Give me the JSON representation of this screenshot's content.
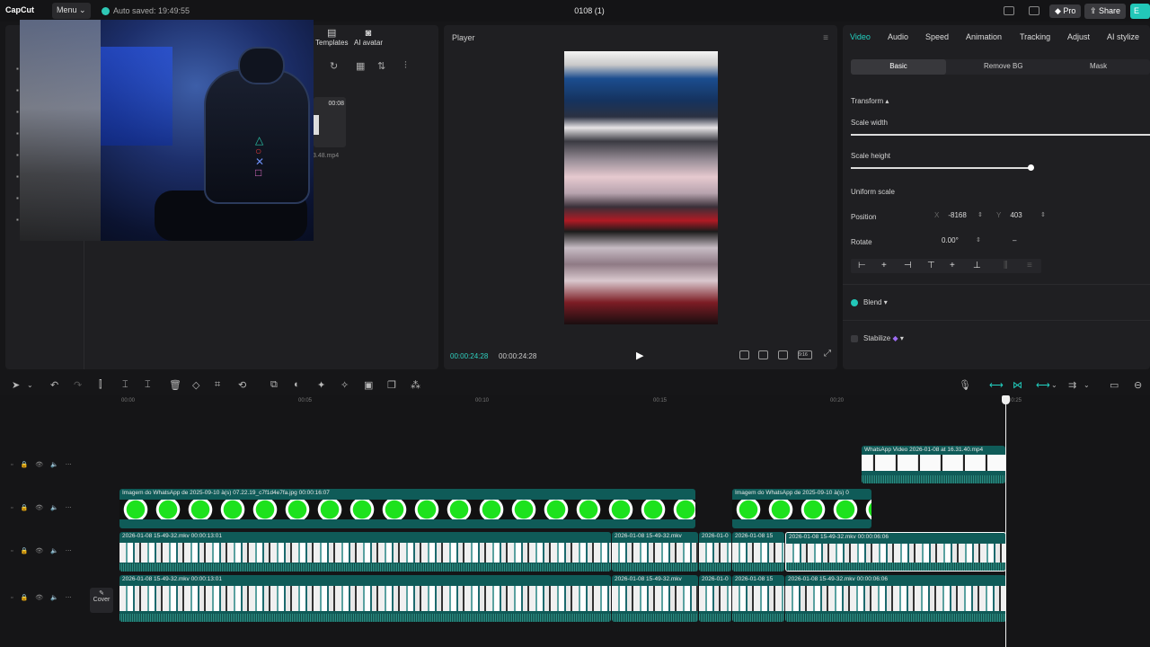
{
  "topbar": {
    "app_name": "CapCut",
    "menu_label": "Menu",
    "autosave": "Auto saved: 19:49:55",
    "project_title": "0108 (1)",
    "pro_label": "Pro",
    "share_label": "Share",
    "export_label": "E"
  },
  "media": {
    "tabs": [
      {
        "label": "Templates",
        "icon": "templates-icon"
      },
      {
        "label": "AI avatar",
        "icon": "ai-avatar-icon"
      }
    ],
    "thumb_duration": "00:08",
    "thumb_filename": "3.48.mp4"
  },
  "player": {
    "title": "Player",
    "current_time": "00:00:24:28",
    "duration": "00:00:24:28",
    "controls": [
      "aspect-icon",
      "full-icon",
      "fit-icon",
      "ratio-icon",
      "fullscreen-icon"
    ],
    "ratio_label": "9:16"
  },
  "props": {
    "tabs": [
      "Video",
      "Audio",
      "Speed",
      "Animation",
      "Tracking",
      "Adjust",
      "AI stylize"
    ],
    "active_tab": "Video",
    "subtabs": [
      "Basic",
      "Remove BG",
      "Mask"
    ],
    "transform_label": "Transform",
    "scale_width_label": "Scale width",
    "scale_height_label": "Scale height",
    "uniform_scale_label": "Uniform scale",
    "position_label": "Position",
    "pos_x_axis": "X",
    "pos_x": "-8168",
    "pos_y_axis": "Y",
    "pos_y": "403",
    "rotate_label": "Rotate",
    "rotate_value": "0.00°",
    "rotate_reset": "–",
    "blend_label": "Blend",
    "stabilize_label": "Stabilize",
    "scale_width_fraction": 1.0,
    "scale_height_fraction": 0.6
  },
  "timeline": {
    "ruler": [
      "00:00",
      "00:05",
      "00:10",
      "00:15",
      "00:20",
      "00:25"
    ],
    "cover_label": "Cover",
    "clips": {
      "wa_video": "WhatsApp Video 2026-01-08 at 16.31.40.mp4",
      "img1": "Imagem do WhatsApp de 2025-09-10 à(s) 07.22.19_c7f1d4e7fa.jpg   00:00:16:07",
      "img2": "Imagem do WhatsApp de 2025-09-10 à(s) 0",
      "v1a": "2026-01-08 15-49-32.mkv   00:00:13:01",
      "v1b": "2026-01-08 15-49-32.mkv",
      "v1c": "2026-01-0",
      "v1d": "2026-01-08 15",
      "v1e": "2026-01-08 15-49-32.mkv   00:00:06:06",
      "v2a": "2026-01-08 15-49-32.mkv   00:00:13:01",
      "v2b": "2026-01-08 15-49-32.mkv",
      "v2c": "2026-01-0",
      "v2d": "2026-01-08 15",
      "v2e": "2026-01-08 15-49-32.mkv   00:00:06:06"
    }
  }
}
